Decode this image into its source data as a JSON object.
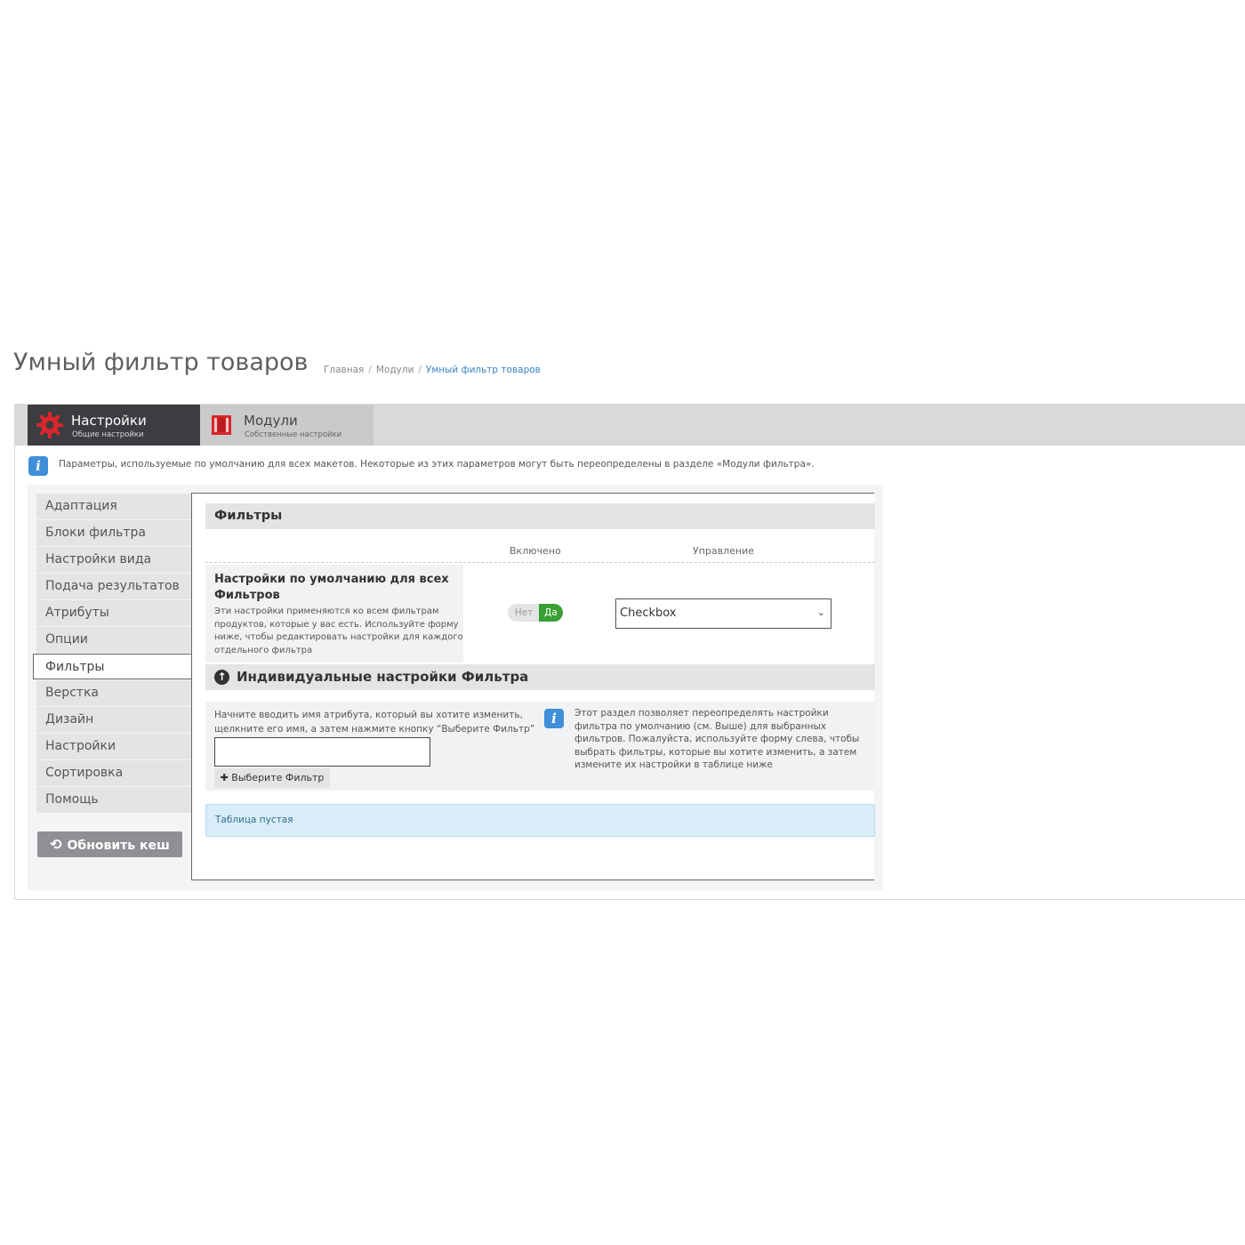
{
  "page": {
    "title": "Умный фильтр товаров",
    "breadcrumb": [
      "Главная",
      "Модули",
      "Умный фильтр товаров"
    ]
  },
  "tabs": [
    {
      "title": "Настройки",
      "subtitle": "Общие настройки",
      "icon": "gear-icon",
      "active": true
    },
    {
      "title": "Модули",
      "subtitle": "Собственные настройки",
      "icon": "modules-icon",
      "active": false
    }
  ],
  "info_note": "Параметры, используемые по умолчанию для всех макетов. Некоторые из этих параметров могут быть переопределены в разделе «Модули фильтра».",
  "sidebar": {
    "items": [
      "Адаптация",
      "Блоки фильтра",
      "Настройки вида",
      "Подача результатов",
      "Атрибуты",
      "Опции",
      "Фильтры",
      "Верстка",
      "Дизайн",
      "Настройки",
      "Сортировка",
      "Помощь"
    ],
    "active_item": "Фильтры",
    "refresh_button": "Обновить кеш"
  },
  "filters_section": {
    "title": "Фильтры",
    "col_enabled": "Включено",
    "col_control": "Управление",
    "defaults_title": "Настройки по умолчанию для всех Фильтров",
    "defaults_desc": "Эти настройки применяются ко всем фильтрам продуктов, которые у вас есть. Используйте форму ниже, чтобы редактировать настройки для каждого отдельного фильтра",
    "toggle": {
      "no": "Нет",
      "yes": "Да",
      "value": "Да"
    },
    "control_select": "Checkbox"
  },
  "individual_section": {
    "title": "Индивидуальные настройки Фильтра",
    "prompt": "Начните вводить имя атрибута, который вы хотите изменить, щелкните его имя, а затем нажмите кнопку “Выберите Фильтр”",
    "input_value": "",
    "button": "Выберите Фильтр",
    "help": "Этот раздел позволяет переопределять настройки фильтра по умолчанию (см. Выше) для выбранных фильтров. Пожалуйста, используйте форму слева, чтобы выбрать фильтры, которые вы хотите изменить, а затем измените их настройки в таблице ниже",
    "empty_table": "Таблица пустая"
  },
  "colors": {
    "accent_blue": "#3f8fd9",
    "toggle_green": "#3aa035",
    "tab_dark": "#3b3d40",
    "gear_red": "#d9262b"
  }
}
